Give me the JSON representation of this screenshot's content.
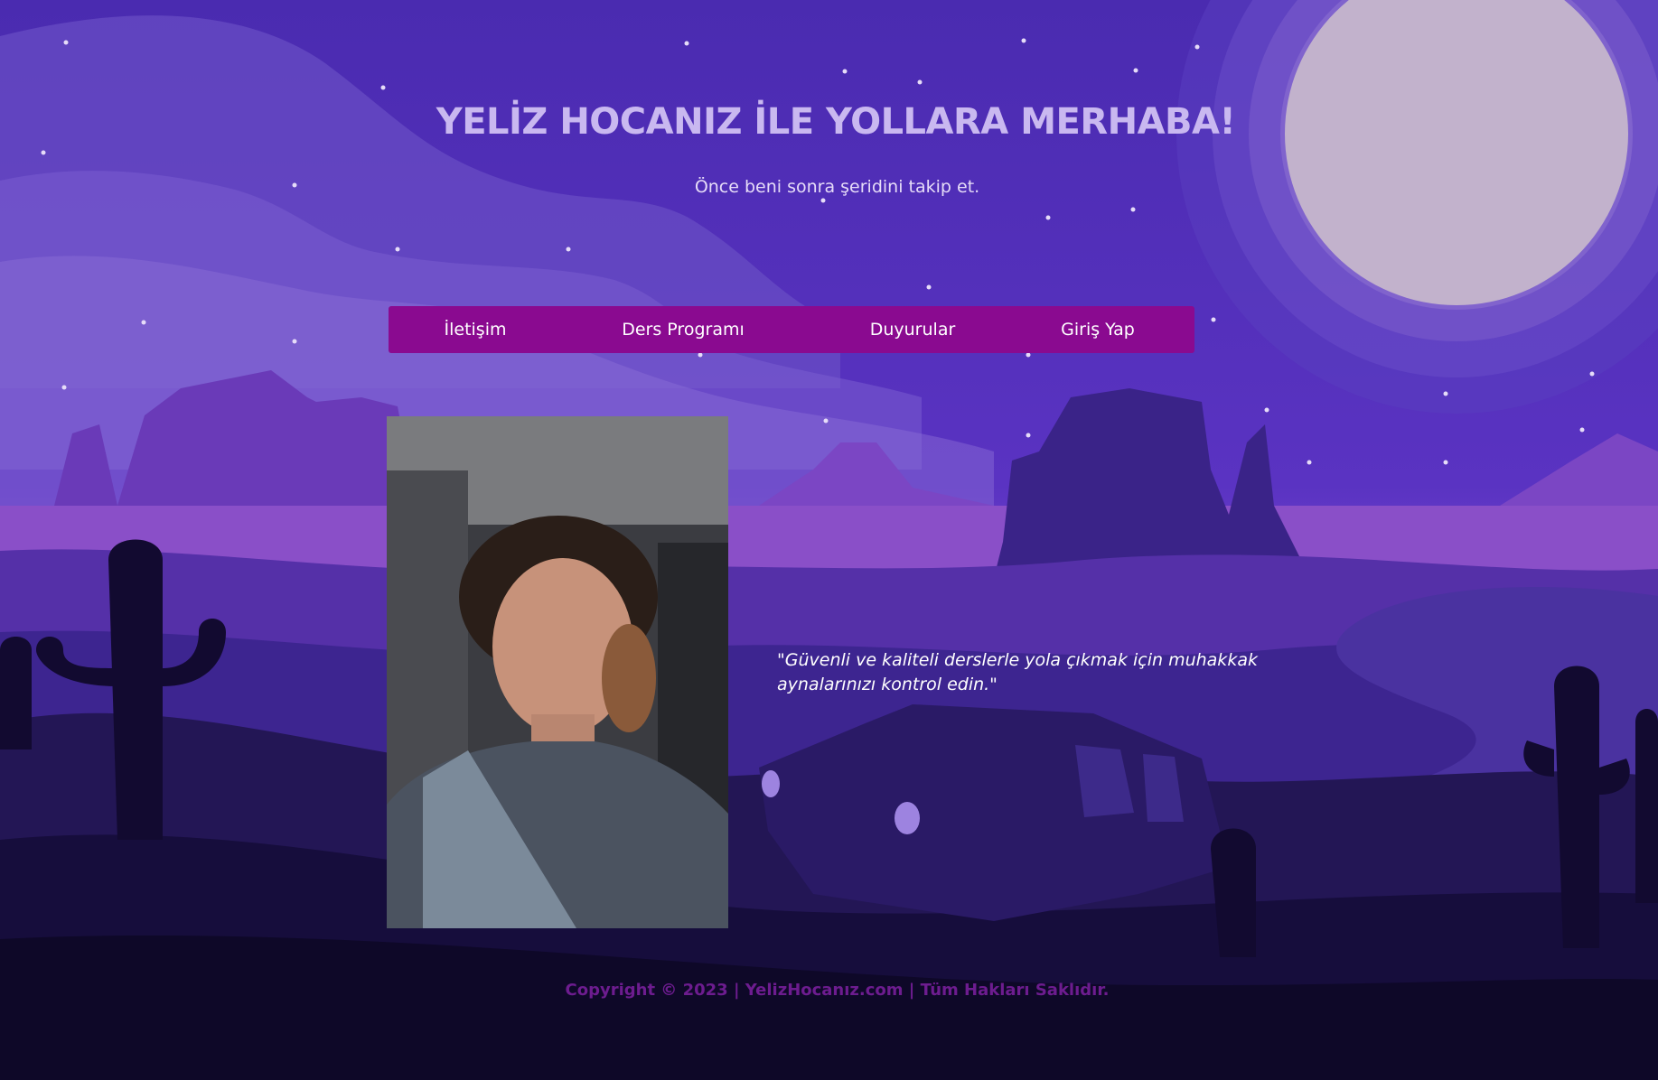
{
  "header": {
    "title": "YELİZ HOCANIZ İLE YOLLARA MERHABA!",
    "subtitle": "Önce beni sonra şeridini takip et."
  },
  "nav": {
    "items": [
      {
        "label": "İletişim"
      },
      {
        "label": "Ders Programı"
      },
      {
        "label": "Duyurular"
      },
      {
        "label": "Giriş Yap"
      }
    ]
  },
  "main": {
    "photo_icon": "portrait-photo",
    "quote": "\"Güvenli ve kaliteli derslerle yola çıkmak için muhakkak aynalarınızı kontrol edin.\""
  },
  "footer": {
    "copyright": "Copyright © 2023 | YelizHocanız.com | Tüm Hakları Saklıdır."
  },
  "colors": {
    "sky": "#4a2bb0",
    "moon": "#c2b2cc",
    "nav_bg": "#8a0a90",
    "title": "#c9b8f0",
    "footer_text": "#6d1c8f"
  }
}
